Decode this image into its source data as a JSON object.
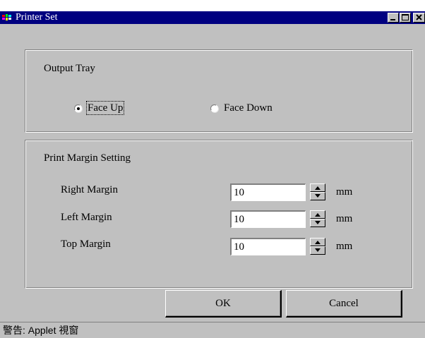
{
  "window": {
    "title": "Printer Set",
    "title_bar_color": "#000080",
    "face_color": "#c0c0c0",
    "controls": [
      "minimize-icon",
      "maximize-icon",
      "close-icon"
    ]
  },
  "output_tray": {
    "title": "Output Tray",
    "options": [
      {
        "label": "Face Up",
        "selected": true
      },
      {
        "label": "Face Down",
        "selected": false
      }
    ]
  },
  "print_margin": {
    "title": "Print Margin Setting",
    "rows": [
      {
        "label": "Right Margin",
        "value": "10",
        "unit": "mm"
      },
      {
        "label": "Left Margin",
        "value": "10",
        "unit": "mm"
      },
      {
        "label": "Top Margin",
        "value": "10",
        "unit": "mm"
      }
    ]
  },
  "buttons": {
    "ok_label": "OK",
    "cancel_label": "Cancel"
  },
  "status_bar": {
    "text": "警告: Applet 視窗"
  }
}
